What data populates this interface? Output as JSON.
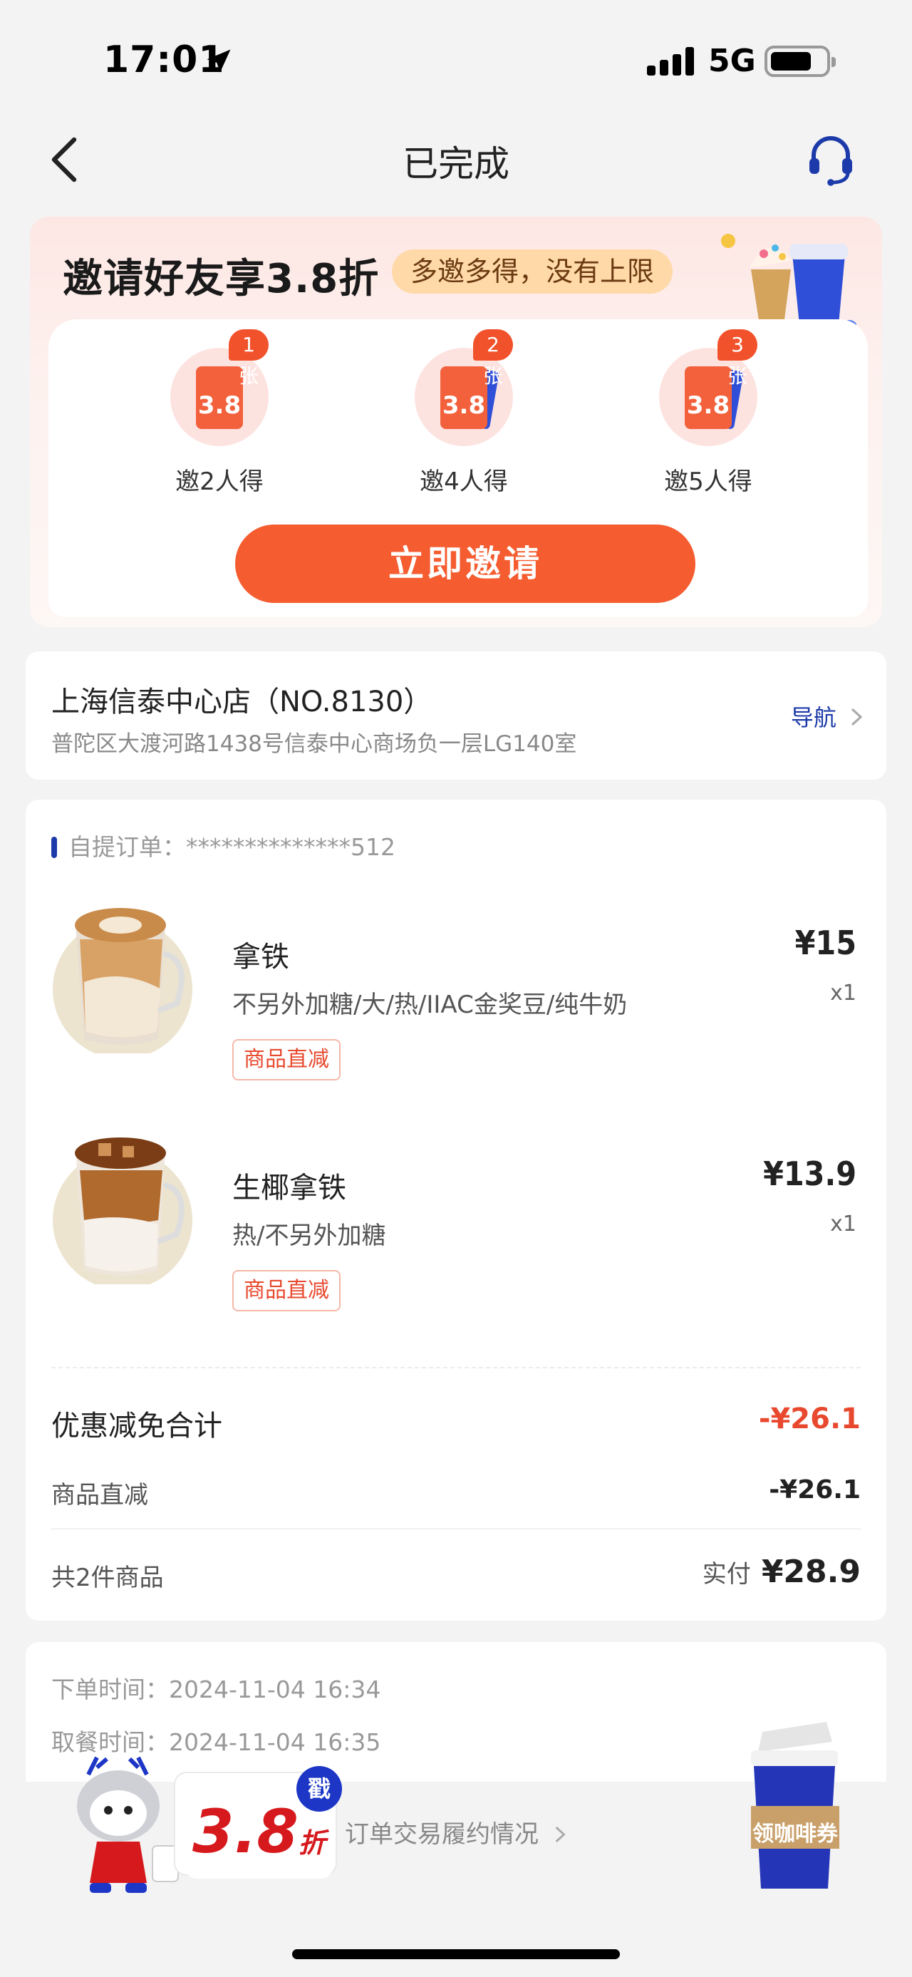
{
  "status_bar": {
    "time": "17:01",
    "network": "5G"
  },
  "nav": {
    "title": "已完成"
  },
  "invite": {
    "title": "邀请好友享3.8折",
    "tag": "多邀多得，没有上限",
    "rewards": [
      {
        "count": "1张",
        "label": "邀2人得",
        "coupon": "3.8"
      },
      {
        "count": "2张",
        "label": "邀4人得",
        "coupon": "3.8"
      },
      {
        "count": "3张",
        "label": "邀5人得",
        "coupon": "3.8"
      }
    ],
    "button": "立即邀请"
  },
  "store": {
    "name": "上海信泰中心店（NO.8130）",
    "address": "普陀区大渡河路1438号信泰中心商场负一层LG140室",
    "nav_label": "导航"
  },
  "order": {
    "number_label": "自提订单：",
    "number": "**************512",
    "items": [
      {
        "name": "拿铁",
        "spec": "不另外加糖/大/热/IIAC金奖豆/纯牛奶",
        "badge": "商品直减",
        "price": "¥15",
        "qty": "x1"
      },
      {
        "name": "生椰拿铁",
        "spec": "热/不另外加糖",
        "badge": "商品直减",
        "price": "¥13.9",
        "qty": "x1"
      }
    ],
    "discount_total_label": "优惠减免合计",
    "discount_total_value": "-¥26.1",
    "direct_discount_label": "商品直减",
    "direct_discount_value": "-¥26.1",
    "count_label": "共2件商品",
    "paid_label": "实付",
    "paid_value": "¥28.9"
  },
  "times": {
    "order_time_label": "下单时间：",
    "order_time": "2024-11-04 16:34",
    "pickup_time_label": "取餐时间：",
    "pickup_time": "2024-11-04 16:35"
  },
  "bottom": {
    "trace_link": "订单交易履约情况",
    "promo_discount": "3.8",
    "promo_unit": "折",
    "promo_stamp": "戳",
    "coffee_coupon": "领咖啡券"
  },
  "colors": {
    "accent": "#f55c30",
    "brand_blue": "#1c3aa9",
    "discount_red": "#e8492e"
  }
}
